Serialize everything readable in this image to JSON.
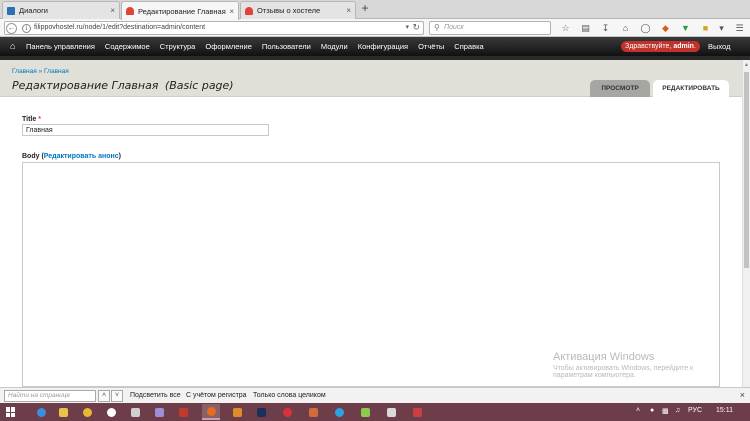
{
  "browser": {
    "tabs": [
      {
        "label": "Диалоги",
        "favicon_color": "#2f6fb3"
      },
      {
        "label": "Редактирование Главная (B",
        "favicon_color": "#e04436"
      },
      {
        "label": "Отзывы о хостеле",
        "favicon_color": "#e04436"
      }
    ],
    "new_tab_symbol": "+",
    "close_symbol": "×",
    "url": "filippovhostel.ru/node/1/edit?destination=admin/content",
    "search_placeholder": "Поиск"
  },
  "toolbar": {
    "home_icon": "home-icon",
    "menu": [
      "Панель управления",
      "Содержимое",
      "Структура",
      "Оформление",
      "Пользователи",
      "Модули",
      "Конфигурация",
      "Отчёты",
      "Справка"
    ],
    "greeting_prefix": "Здравствуйте,",
    "greeting_user": "admin",
    "greeting_suffix": ".",
    "logout": "Выход"
  },
  "page": {
    "breadcrumb": [
      "Главная",
      "Главная"
    ],
    "breadcrumb_separator": "»",
    "title": "Редактирование Главная",
    "title_type": "(Basic page)",
    "tabs": {
      "view": "Просмотр",
      "edit": "Редактировать"
    }
  },
  "form": {
    "title_label": "Title",
    "required_mark": "*",
    "title_value": "Главная",
    "body_label": "Body",
    "body_link": "Редактировать анонс",
    "body_value": ""
  },
  "watermark": {
    "line1": "Активация Windows",
    "line2": "Чтобы активировать Windows, перейдите к",
    "line3": "параметрам компьютера."
  },
  "findbar": {
    "placeholder": "Найти на странице",
    "highlight_all": "Подсветить все",
    "match_case": "С учётом регистра",
    "whole_words": "Только слова целиком"
  },
  "taskbar": {
    "language": "РУС",
    "time": "15:11"
  },
  "colors": {
    "accent_link": "#0074bd",
    "toolbar_bg": "#1a1a1a",
    "greeting_bg": "#c0322b",
    "taskbar_bg": "#6e3d4a"
  }
}
